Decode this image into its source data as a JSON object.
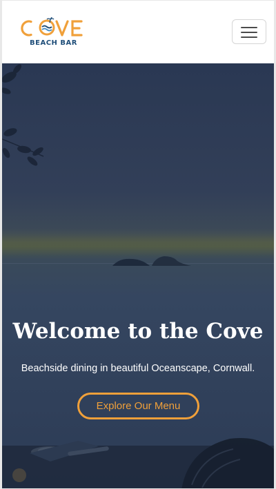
{
  "brand": {
    "name": "COVE",
    "subtitle": "BEACH BAR",
    "primary_color": "#f0a03a",
    "secondary_color": "#1f4e79"
  },
  "nav": {
    "menu_icon": "hamburger-icon"
  },
  "hero": {
    "title": "Welcome to the Cove",
    "subtitle": "Beachside dining in beautiful Oceanscape, Cornwall.",
    "cta_label": "Explore Our Menu",
    "overlay_color": "#2c3a55",
    "accent_color": "#f0a03a"
  }
}
